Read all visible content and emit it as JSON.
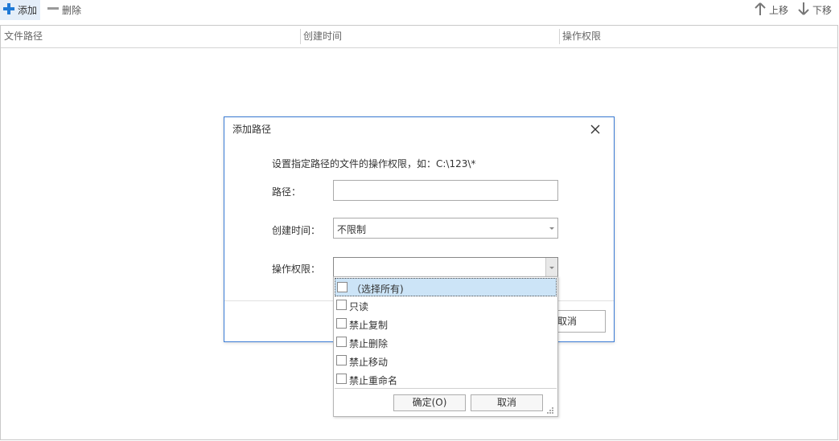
{
  "toolbar": {
    "add_label": "添加",
    "delete_label": "删除",
    "up_label": "上移",
    "down_label": "下移"
  },
  "grid": {
    "columns": [
      "文件路径",
      "创建时间",
      "操作权限"
    ]
  },
  "dialog": {
    "title": "添加路径",
    "description": "设置指定路径的文件的操作权限，如：C:\\123\\*",
    "path_label": "路径：",
    "path_value": "",
    "created_label": "创建时间：",
    "created_value": "不限制",
    "permission_label": "操作权限：",
    "permission_value": "",
    "cancel_label": "取消"
  },
  "dropdown": {
    "items": [
      "（选择所有)",
      "只读",
      "禁止复制",
      "禁止删除",
      "禁止移动",
      "禁止重命名"
    ],
    "ok_label": "确定(O)",
    "cancel_label": "取消"
  },
  "colors": {
    "accent": "#1e79d6",
    "dialog_border": "#3a7bd5",
    "selected_item_bg": "#cce4f7"
  }
}
